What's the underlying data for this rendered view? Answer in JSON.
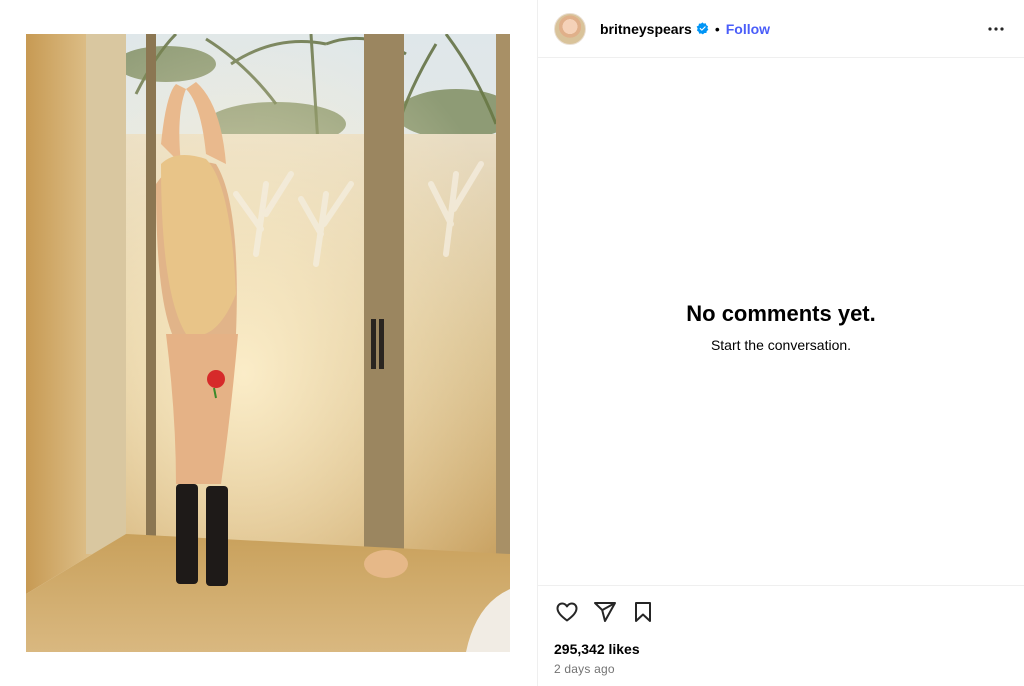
{
  "colors": {
    "follow": "#4a5df9",
    "verified": "#0095f6",
    "muted": "#737373",
    "divider": "#efefef"
  },
  "post": {
    "author": {
      "username": "britneyspears",
      "verified": true
    },
    "follow_label": "Follow",
    "separator": "•",
    "likes": "295,342 likes",
    "time_ago": "2 days ago"
  },
  "comments": {
    "empty_title": "No comments yet.",
    "empty_subtitle": "Start the conversation."
  },
  "icons": {
    "more": "more-options-icon",
    "like": "heart-icon",
    "share": "paper-plane-icon",
    "save": "bookmark-icon",
    "verified": "verified-badge-icon"
  }
}
